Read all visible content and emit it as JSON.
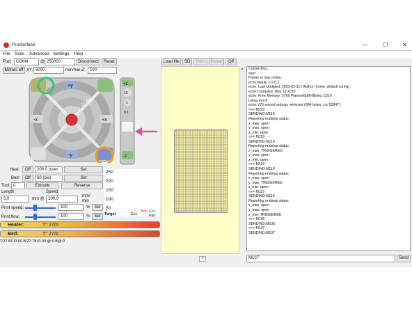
{
  "window": {
    "title": "Pronterface",
    "controls": [
      "—",
      "☐",
      "✕"
    ]
  },
  "menu": [
    "File",
    "Tools",
    "Advanced",
    "Settings",
    "Help"
  ],
  "toolbar": {
    "port_label": "Port",
    "port_value": "COM4",
    "at": "@",
    "baud_value": "250000",
    "disconnect": "Disconnect",
    "reset": "Reset",
    "load_file": "Load file",
    "sd": "SD",
    "print": "Print",
    "pause": "Pause",
    "off": "Off"
  },
  "row2": {
    "motors_off": "Motors off",
    "xy_label": "XY:",
    "xy_value": "3000",
    "xy_unit": "mm/min Z:",
    "z_value": "100"
  },
  "jog": {
    "plus_x": "+x",
    "minus_x": "-x",
    "plus_y": "+y",
    "minus_y": "-y",
    "plus_z": "+z",
    "minus_z": "-z",
    "rings": [
      "100",
      "10",
      "1",
      "0.1"
    ],
    "z_steps": [
      "10",
      "1",
      "0.1"
    ]
  },
  "heat": {
    "heat_label": "Heat:",
    "heat_off": "Off",
    "heat_value": "200.0 (user",
    "heat_set": "Set",
    "bed_label": "Bed:",
    "bed_off": "Off",
    "bed_value": "60 (pla)",
    "bed_set": "Set",
    "tool_label": "Tool:",
    "tool_value": "0",
    "extrude": "Extrude",
    "reverse": "Reverse",
    "length_label": "Length:",
    "length_value": "5.0",
    "length_unit": "mm @",
    "speed_label": "Speed:",
    "speed_value": "100.0",
    "speed_unit1": "mm/",
    "speed_unit2": "min",
    "print_speed_label": "Print speed:",
    "print_speed_value": "100",
    "pct": "%",
    "print_speed_set": "Set",
    "print_flow_label": "Print flow:",
    "print_flow_value": "100",
    "print_flow_set": "Set"
  },
  "graph": {
    "ticks": [
      "250",
      "200",
      "150",
      "100",
      "50"
    ],
    "legend": [
      "Target",
      "Ex1",
      "Bed",
      "Ex0",
      "Fan"
    ]
  },
  "bars": {
    "heater_label": "Heater:",
    "heater_value": "T° 27/0",
    "bed_label": "Bed:",
    "bed_value": "T° 27/0"
  },
  "status_line": "T:27.84 /0.00 B:27.78 /0.00 @:0 B@:0",
  "console_lines": [
    "Connecting...",
    "start",
    "Printer is now online.",
    "echo:Marlin 2.0.5.3",
    "echo: Last Updated: 2020-03-31 | Author: (none, default config)",
    "echo:Compiled: May 19 2020",
    "echo: Free Memory: 3769 PlannerBufferBytes: 1216",
    "Using tool 0.",
    "echo:V76 stored settings retrieved (684 bytes; crc 50347)",
    ">>> M119",
    "SENDING:M119",
    "Reporting endstop status",
    "x_max: open",
    "y_max: open",
    "z_min: open",
    ">>> M119",
    "SENDING:M119",
    "Reporting endstop status",
    "x_max: TRIGGERED",
    "y_max: open",
    "z_min: open",
    ">>> M119",
    "SENDING:M119",
    "Reporting endstop status",
    "x_max: open",
    "y_max: TRIGGERED",
    "z_min: open",
    ">>> M119",
    "SENDING:M119",
    "Reporting endstop status",
    "x_max: open",
    "y_max: open",
    "z_min: TRIGGERED",
    ">>> M106",
    "SENDING:M106",
    ">>> M107",
    "SENDING:M107"
  ],
  "command_input": "M107",
  "send": "Send",
  "colors": {
    "green_highlight": "#2ecc71",
    "orange_highlight": "#f39c12",
    "pink_arrow": "#e0509a"
  }
}
